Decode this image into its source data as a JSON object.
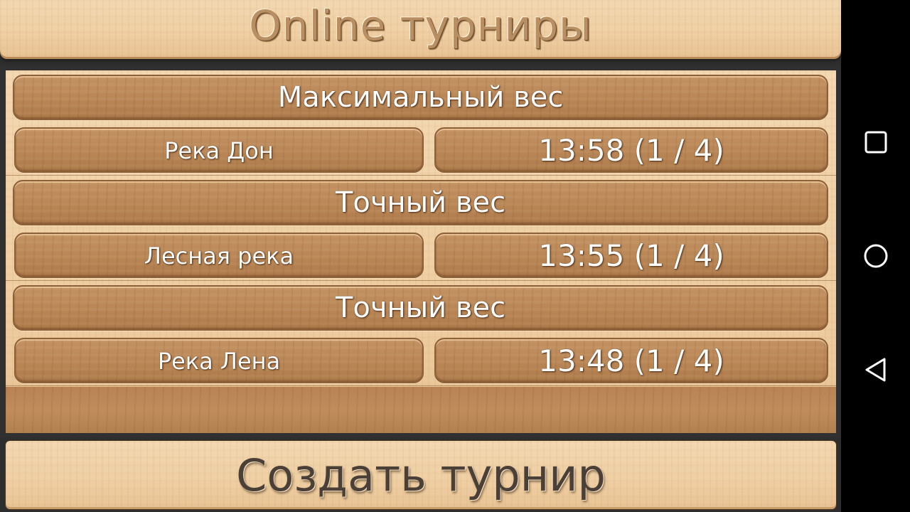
{
  "header": {
    "title": "Online турниры"
  },
  "tournaments": [
    {
      "type": "Максимальный вес",
      "location": "Река Дон",
      "time": "13:58 (1 / 4)"
    },
    {
      "type": "Точный вес",
      "location": "Лесная река",
      "time": "13:55 (1 / 4)"
    },
    {
      "type": "Точный вес",
      "location": "Река Лена",
      "time": "13:48 (1 / 4)"
    }
  ],
  "footer": {
    "create_label": "Создать турнир"
  },
  "nav": {
    "recents_icon": "square-icon",
    "home_icon": "circle-icon",
    "back_icon": "triangle-back-icon"
  }
}
